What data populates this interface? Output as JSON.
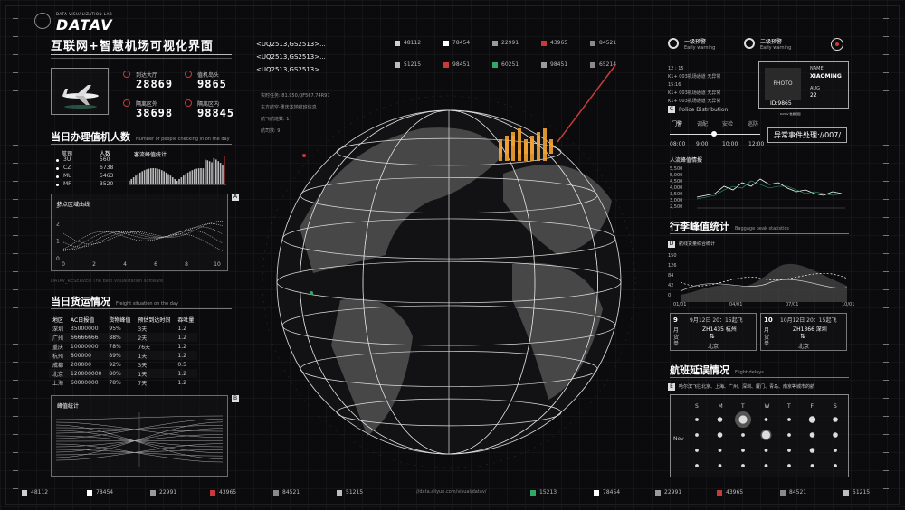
{
  "brand": {
    "lab": "DATA VISUALIZATION LAB",
    "logo": "DATAV"
  },
  "header": {
    "title": "互联网+智慧机场可视化界面"
  },
  "airport_stats": [
    {
      "label": "到达大厅",
      "value": "28869"
    },
    {
      "label": "值机岛头",
      "value": "9865"
    },
    {
      "label": "隔离区外",
      "value": "38698"
    },
    {
      "label": "隔离区内",
      "value": "98845"
    }
  ],
  "checkin": {
    "title": "当日办理值机人数",
    "subtitle": "Number of people checking in on the day",
    "col_airline": "航司",
    "col_people": "人数",
    "chart_label": "客流峰值统计",
    "rows": [
      {
        "airline": "3U",
        "count": "560"
      },
      {
        "airline": "CZ",
        "count": "6738"
      },
      {
        "airline": "MU",
        "count": "5463"
      },
      {
        "airline": "MF",
        "count": "3520"
      }
    ]
  },
  "hot_area": {
    "title": "热点区域曲线",
    "badge": "A",
    "xticks": [
      "0",
      "2",
      "4",
      "6",
      "8",
      "10"
    ],
    "yticks": [
      "3",
      "2",
      "1",
      "0"
    ]
  },
  "footer_note": "DATAV_RESERVED The best visualization software",
  "cargo": {
    "title": "当日货运情况",
    "subtitle": "Freight situation on the day",
    "headers": [
      "地区",
      "AC日报值",
      "货物峰值",
      "预估到达时间",
      "吞吐量"
    ],
    "rows": [
      [
        "深圳",
        "35000000",
        "95%",
        "3天",
        "1.2"
      ],
      [
        "广州",
        "66666666",
        "88%",
        "2天",
        "1.2"
      ],
      [
        "重庆",
        "10000000",
        "78%",
        "76天",
        "1.2"
      ],
      [
        "杭州",
        "800000",
        "89%",
        "1天",
        "1.2"
      ],
      [
        "成都",
        "200000",
        "92%",
        "3天",
        "0.5"
      ],
      [
        "北京",
        "120000000",
        "80%",
        "1天",
        "1.2"
      ],
      [
        "上海",
        "60000000",
        "78%",
        "7天",
        "1.2"
      ]
    ]
  },
  "peak": {
    "title": "峰值统计",
    "badge": "B"
  },
  "flight_codes": [
    "<UQ2513,GS2513>...",
    "<UQ2513,GS2513>...",
    "<UQ2513,GS2513>..."
  ],
  "info_lines": [
    "实时任务: 81.950,QF567.74R97",
    "东方航空-重庆本地航班信息",
    "航飞航班数: 1",
    "航司数: 9"
  ],
  "top_legend": [
    {
      "value": "48112",
      "color": "#cfcfcf"
    },
    {
      "value": "78454",
      "color": "#ffffff"
    },
    {
      "value": "22991",
      "color": "#9a9a9a"
    },
    {
      "value": "43965",
      "color": "#c83a3a"
    },
    {
      "value": "84521",
      "color": "#8a8a8a"
    },
    {
      "value": "51215",
      "color": "#bdbdbd"
    },
    {
      "value": "98451",
      "color": "#c83a3a"
    },
    {
      "value": "60251",
      "color": "#2fa86a"
    },
    {
      "value": "98451",
      "color": "#9a9a9a"
    },
    {
      "value": "65214",
      "color": "#8a8a8a"
    }
  ],
  "warnings": [
    {
      "label": "一级预警",
      "sub": "Early warning"
    },
    {
      "label": "二级预警",
      "sub": "Early warning"
    }
  ],
  "staff": {
    "lines": [
      "12 : 15",
      "K1+ 003机场通道 无异常",
      "15:16",
      "K1+ 003机场通道 无异常",
      "K1+ 003机场通道 无异常"
    ],
    "photo": "PHOTO",
    "name_label": "NAME",
    "name": "XIAOMING",
    "aug_label": "AUG",
    "aug": "22",
    "id_label": "ID:",
    "id": "9865"
  },
  "police": {
    "badge": "C",
    "title": "Police Distribution",
    "legend": "DATAV 数据视图",
    "tabs": [
      "门警",
      "调配",
      "安检",
      "巡防"
    ],
    "times": [
      "08:00",
      "9:00",
      "10:00",
      "12:00"
    ],
    "event_button": "异常事件处理://007/"
  },
  "flow": {
    "title": "人流峰值情报",
    "yticks": [
      "5,500",
      "5,000",
      "4,500",
      "4,000",
      "3,500",
      "3,000",
      "2,500"
    ]
  },
  "baggage": {
    "title": "行李峰值统计",
    "subtitle": "Baggage peak statistics",
    "badge": "D",
    "chart_title": "航线货量综合统计",
    "yticks": [
      "150",
      "126",
      "84",
      "42",
      "0"
    ],
    "xticks": [
      "01/01",
      "04/01",
      "07/01",
      "10/01"
    ]
  },
  "flight_cards": [
    {
      "month": "9",
      "unit": "月",
      "label": "货单",
      "date": "9月12日 20：15起飞",
      "code": "ZH1435 杭州",
      "dest": "北京"
    },
    {
      "month": "10",
      "unit": "月",
      "label": "货单",
      "date": "10月12日 20：15起飞",
      "code": "ZH1366 深圳",
      "dest": "北京"
    }
  ],
  "delays": {
    "title": "航班延误情况",
    "subtitle": "Flight delays",
    "badge": "E",
    "cities_text": "哈尔滨飞往北京、上海、广州、深圳、厦门、青岛、南京等城市的航",
    "days": [
      "S",
      "M",
      "T",
      "W",
      "T",
      "F",
      "S"
    ],
    "month": "Nov"
  },
  "bottom_legend": [
    {
      "value": "48112",
      "color": "#cfcfcf"
    },
    {
      "value": "78454",
      "color": "#ffffff"
    },
    {
      "value": "22991",
      "color": "#9a9a9a"
    },
    {
      "value": "43965",
      "color": "#c83a3a"
    },
    {
      "value": "84521",
      "color": "#8a8a8a"
    },
    {
      "value": "51215",
      "color": "#bdbdbd"
    },
    {
      "value": "15213",
      "color": "#2fa86a"
    },
    {
      "value": "78454",
      "color": "#ffffff"
    },
    {
      "value": "22991",
      "color": "#9a9a9a"
    },
    {
      "value": "43965",
      "color": "#c83a3a"
    },
    {
      "value": "84521",
      "color": "#8a8a8a"
    },
    {
      "value": "51215",
      "color": "#bdbdbd"
    }
  ],
  "url": "//data.aliyun.com/visual/datav/"
}
